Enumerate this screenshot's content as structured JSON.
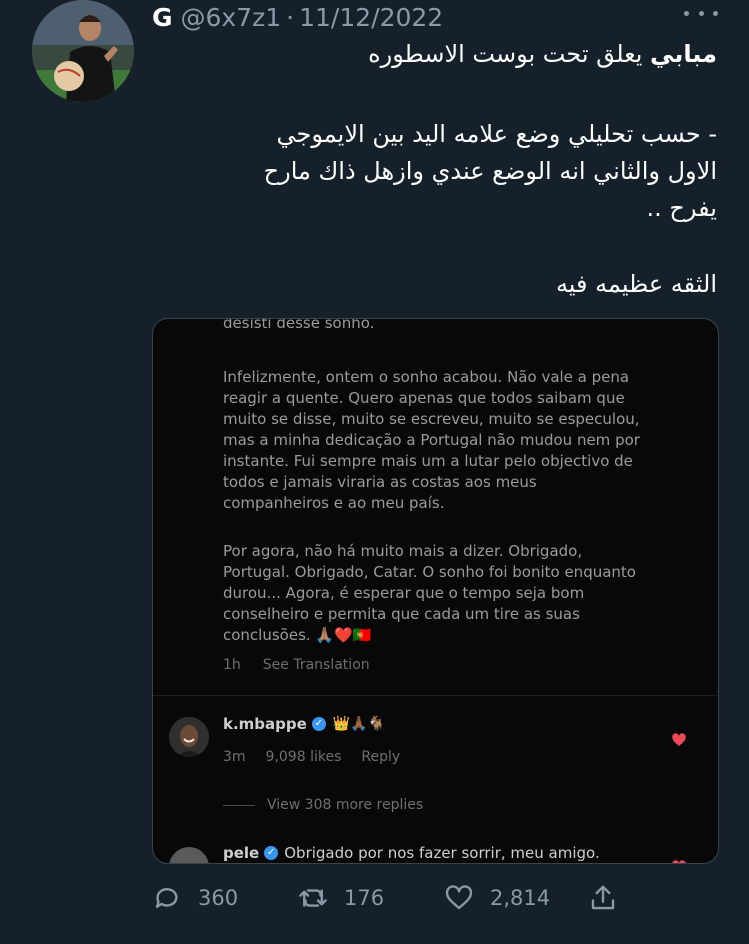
{
  "header": {
    "name": "G",
    "handle": "@6x7z1",
    "separator": "·",
    "date": "11/12/2022"
  },
  "tweet": {
    "line1_bold": "مبابي",
    "line1_rest": " يعلق تحت بوست الاسطوره",
    "line2": "- حسب تحليلي وضع علامه اليد بين الايموجي",
    "line3": "الاول والثاني انه الوضع عندي وازهل ذاك مارح",
    "line4": "يفرح ..",
    "line5": "الثقه عظيمه فيه"
  },
  "media": {
    "cut_line": "desisti desse sonho.",
    "para1": [
      "Infelizmente, ontem o sonho acabou. Não vale a pena",
      "reagir a quente. Quero apenas que todos saibam que",
      "muito se disse, muito se escreveu, muito se especulou,",
      "mas a minha dedicação a Portugal não mudou nem por",
      "instante. Fui sempre mais um a lutar pelo objectivo de",
      "todos e jamais viraria as costas aos meus",
      "companheiros e ao meu país."
    ],
    "para2": [
      "Por agora, não há muito mais a dizer. Obrigado,",
      "Portugal. Obrigado, Catar. O sonho foi bonito enquanto",
      "durou... Agora, é esperar que o tempo seja bom",
      "conselheiro e permita que cada um tire as suas",
      "conclusões. 🙏🏽❤️🇵🇹"
    ],
    "post_time": "1h",
    "see_translation": "See Translation",
    "comment": {
      "username": "k.mbappe",
      "emojis": "👑🙏🏾🐐",
      "time": "3m",
      "likes": "9,098 likes",
      "reply": "Reply"
    },
    "view_more": "View 308 more replies",
    "comment2": {
      "username": "pele",
      "text": "Obrigado por nos fazer sorrir, meu amigo."
    },
    "heart_color": "#ed4956",
    "verified_color": "#3897f0"
  },
  "actions": {
    "replies": "360",
    "retweets": "176",
    "likes": "2,814"
  },
  "icons": [
    "reply-icon",
    "retweet-icon",
    "like-icon",
    "share-icon",
    "more-icon",
    "verified-icon",
    "heart-icon"
  ]
}
